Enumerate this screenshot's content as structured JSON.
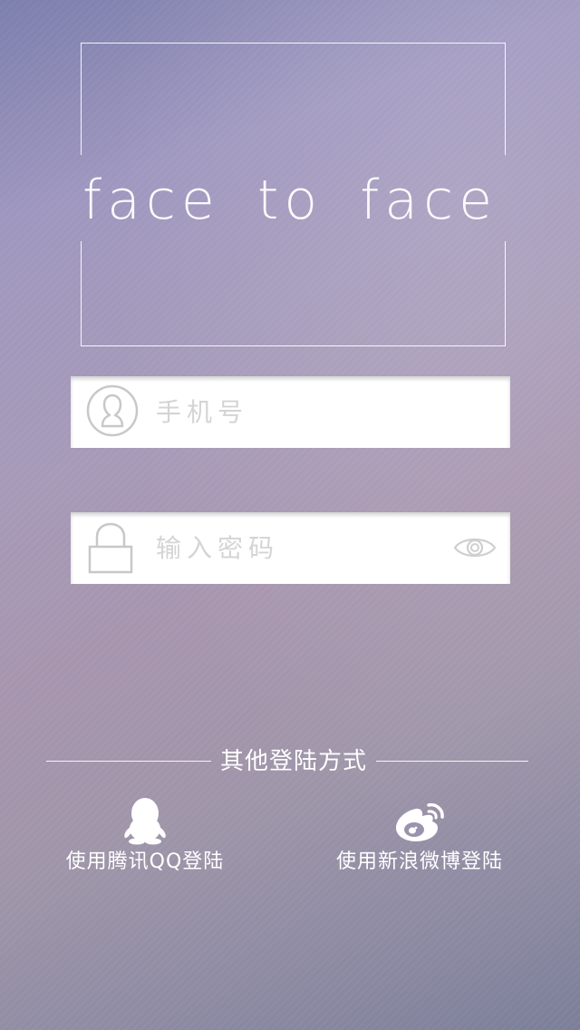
{
  "app": {
    "title": "face to face"
  },
  "login_form": {
    "phone_placeholder": "手机号",
    "password_placeholder": "输入密码"
  },
  "icons": {
    "phone_field": "user-avatar-icon",
    "password_field": "lock-icon",
    "toggle_password": "eye-icon",
    "qq": "qq-penguin-icon",
    "weibo": "weibo-icon"
  },
  "other_login": {
    "heading": "其他登陆方式",
    "qq_label": "使用腾讯QQ登陆",
    "weibo_label": "使用新浪微博登陆"
  },
  "colors": {
    "background_top": "#7c7fad",
    "background_mid": "#a795ae",
    "background_bottom": "#7c7f99",
    "field_background": "#ffffff",
    "field_icon": "#c8c8c8",
    "text": "#ffffff"
  }
}
